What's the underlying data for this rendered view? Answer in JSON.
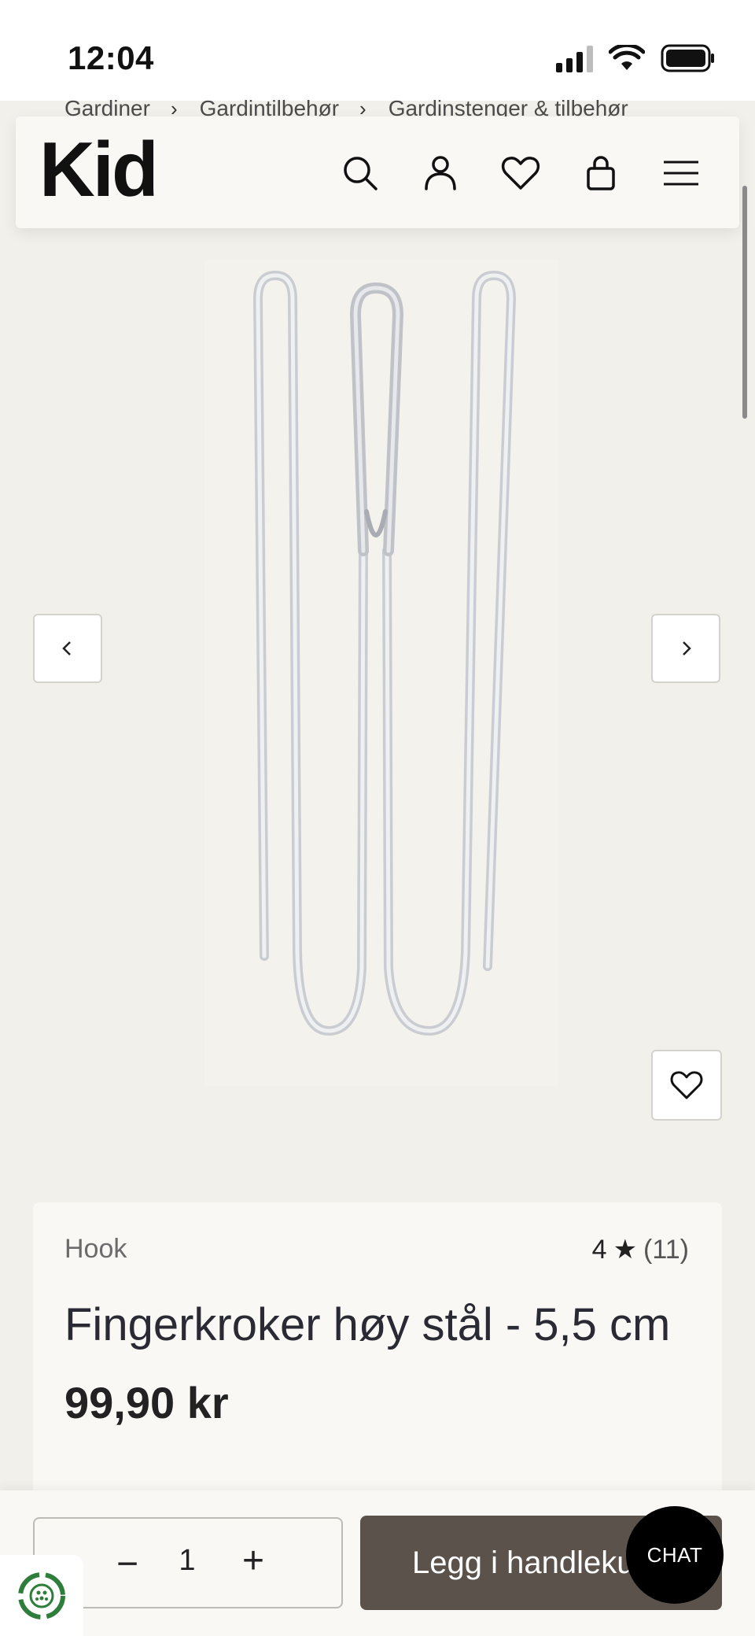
{
  "status": {
    "time": "12:04"
  },
  "breadcrumb": [
    "Gardiner",
    "Gardintilbehør",
    "Gardinstenger & tilbehør"
  ],
  "header": {
    "logo": "Kid"
  },
  "product": {
    "brand": "Hook",
    "rating": "4",
    "rating_star": "★",
    "review_count": "(11)",
    "title": "Fingerkroker høy stål - 5,5 cm",
    "price": "99,90 kr"
  },
  "cart": {
    "quantity": "1",
    "minus": "−",
    "plus": "+",
    "add_label": "Legg i handlekurv"
  },
  "chat": {
    "label": "CHAT"
  },
  "colors": {
    "accent": "#5a524b",
    "background": "#f2f0ea",
    "card": "#f9f8f4"
  }
}
